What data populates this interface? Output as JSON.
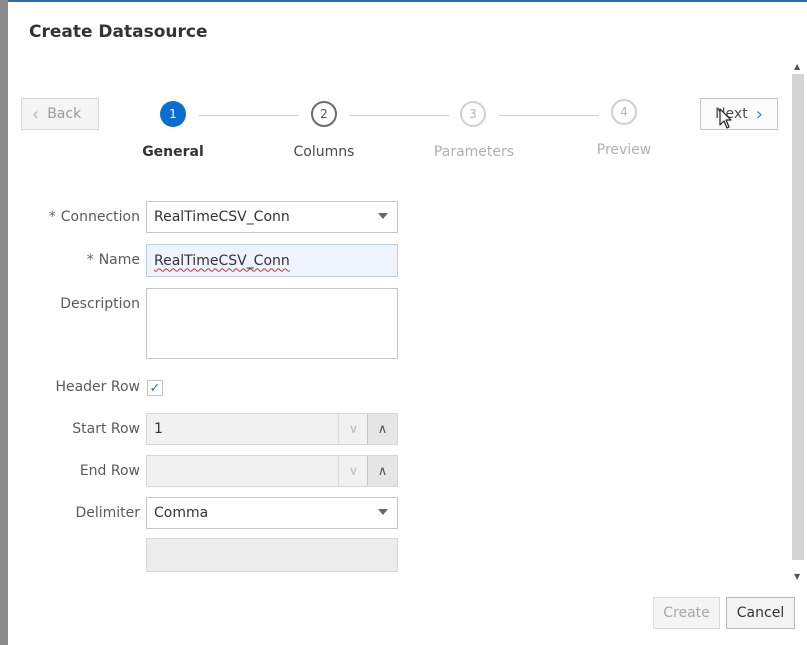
{
  "dialog": {
    "title": "Create Datasource"
  },
  "wizard": {
    "back_label": "Back",
    "next_label": "Next",
    "steps": [
      {
        "number": "1",
        "label": "General",
        "state": "active"
      },
      {
        "number": "2",
        "label": "Columns",
        "state": "normal"
      },
      {
        "number": "3",
        "label": "Parameters",
        "state": "disabled"
      },
      {
        "number": "4",
        "label": "Preview",
        "state": "disabled"
      }
    ]
  },
  "form": {
    "connection": {
      "label": "Connection",
      "required": true,
      "value": "RealTimeCSV_Conn"
    },
    "name": {
      "label": "Name",
      "required": true,
      "value": "RealTimeCSV_Conn"
    },
    "description": {
      "label": "Description",
      "value": ""
    },
    "header_row": {
      "label": "Header Row",
      "checked": true
    },
    "start_row": {
      "label": "Start Row",
      "value": "1"
    },
    "end_row": {
      "label": "End Row",
      "value": ""
    },
    "delimiter": {
      "label": "Delimiter",
      "value": "Comma"
    },
    "required_marker": "*"
  },
  "footer": {
    "create_label": "Create",
    "cancel_label": "Cancel"
  },
  "colors": {
    "accent": "#0a6ed1",
    "focus_bg": "#eef4fd"
  },
  "icons": {
    "back": "chevron-left-icon",
    "next": "chevron-right-icon",
    "dropdown": "caret-down-icon",
    "check": "checkmark-icon"
  }
}
